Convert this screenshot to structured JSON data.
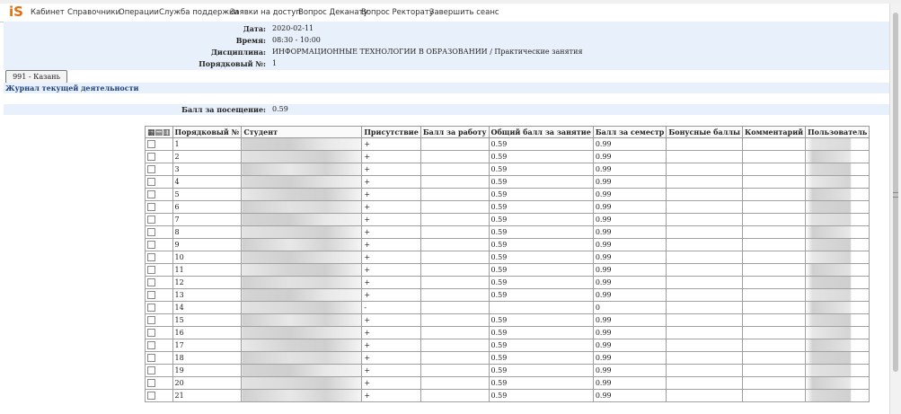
{
  "logo": "iS",
  "menu": [
    "Кабинет",
    "Справочники",
    "Операции",
    "Служба поддержки",
    "Заявки на доступ",
    "Вопрос Деканату",
    "Вопрос Ректорату",
    "Завершить сеанс"
  ],
  "info": {
    "date_label": "Дата:",
    "date": "2020-02-11",
    "time_label": "Время:",
    "time": "08:30 - 10:00",
    "discipline_label": "Дисциплина:",
    "discipline": "ИНФОРМАЦИОННЫЕ ТЕХНОЛОГИИ В ОБРАЗОВАНИИ / Практические занятия",
    "seq_label": "Порядковый №:",
    "seq": "1"
  },
  "group_button": "991 - Казань",
  "journal_title": "Журнал текущей деятельности",
  "attendance": {
    "label": "Балл за посещение:",
    "value": "0.59"
  },
  "table": {
    "header_icons": "▦▤▥",
    "columns": [
      "Порядковый №",
      "Студент",
      "Присутствие",
      "Балл за работу",
      "Общий балл за занятие",
      "Балл за семестр",
      "Бонусные баллы",
      "Комментарий",
      "Пользователь"
    ],
    "rows": [
      {
        "n": "1",
        "presence": "+",
        "work": "",
        "total": "0.59",
        "semester": "0.99",
        "bonus": "",
        "comment": ""
      },
      {
        "n": "2",
        "presence": "+",
        "work": "",
        "total": "0.59",
        "semester": "0.99",
        "bonus": "",
        "comment": ""
      },
      {
        "n": "3",
        "presence": "+",
        "work": "",
        "total": "0.59",
        "semester": "0.99",
        "bonus": "",
        "comment": ""
      },
      {
        "n": "4",
        "presence": "+",
        "work": "",
        "total": "0.59",
        "semester": "0.99",
        "bonus": "",
        "comment": ""
      },
      {
        "n": "5",
        "presence": "+",
        "work": "",
        "total": "0.59",
        "semester": "0.99",
        "bonus": "",
        "comment": ""
      },
      {
        "n": "6",
        "presence": "+",
        "work": "",
        "total": "0.59",
        "semester": "0.99",
        "bonus": "",
        "comment": ""
      },
      {
        "n": "7",
        "presence": "+",
        "work": "",
        "total": "0.59",
        "semester": "0.99",
        "bonus": "",
        "comment": ""
      },
      {
        "n": "8",
        "presence": "+",
        "work": "",
        "total": "0.59",
        "semester": "0.99",
        "bonus": "",
        "comment": ""
      },
      {
        "n": "9",
        "presence": "+",
        "work": "",
        "total": "0.59",
        "semester": "0.99",
        "bonus": "",
        "comment": ""
      },
      {
        "n": "10",
        "presence": "+",
        "work": "",
        "total": "0.59",
        "semester": "0.99",
        "bonus": "",
        "comment": ""
      },
      {
        "n": "11",
        "presence": "+",
        "work": "",
        "total": "0.59",
        "semester": "0.99",
        "bonus": "",
        "comment": ""
      },
      {
        "n": "12",
        "presence": "+",
        "work": "",
        "total": "0.59",
        "semester": "0.99",
        "bonus": "",
        "comment": ""
      },
      {
        "n": "13",
        "presence": "+",
        "work": "",
        "total": "0.59",
        "semester": "0.99",
        "bonus": "",
        "comment": ""
      },
      {
        "n": "14",
        "presence": "-",
        "work": "",
        "total": "",
        "semester": "0",
        "bonus": "",
        "comment": ""
      },
      {
        "n": "15",
        "presence": "+",
        "work": "",
        "total": "0.59",
        "semester": "0.99",
        "bonus": "",
        "comment": ""
      },
      {
        "n": "16",
        "presence": "+",
        "work": "",
        "total": "0.59",
        "semester": "0.99",
        "bonus": "",
        "comment": ""
      },
      {
        "n": "17",
        "presence": "+",
        "work": "",
        "total": "0.59",
        "semester": "0.99",
        "bonus": "",
        "comment": ""
      },
      {
        "n": "18",
        "presence": "+",
        "work": "",
        "total": "0.59",
        "semester": "0.99",
        "bonus": "",
        "comment": ""
      },
      {
        "n": "19",
        "presence": "+",
        "work": "",
        "total": "0.59",
        "semester": "0.99",
        "bonus": "",
        "comment": ""
      },
      {
        "n": "20",
        "presence": "+",
        "work": "",
        "total": "0.59",
        "semester": "0.99",
        "bonus": "",
        "comment": ""
      },
      {
        "n": "21",
        "presence": "+",
        "work": "",
        "total": "0.59",
        "semester": "0.99",
        "bonus": "",
        "comment": ""
      }
    ]
  }
}
